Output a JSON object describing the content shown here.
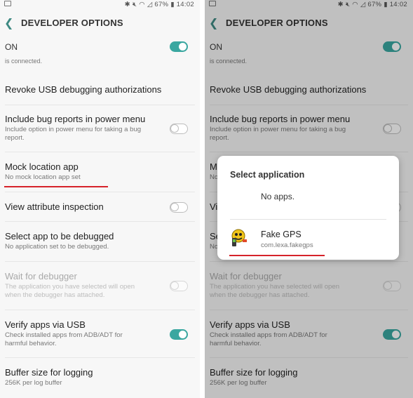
{
  "status": {
    "battery": "67%",
    "time": "14:02",
    "icons": [
      "image-icon",
      "bluetooth-icon",
      "mute-icon",
      "wifi-icon",
      "no-signal-icon",
      "battery-icon"
    ]
  },
  "header": {
    "title": "DEVELOPER OPTIONS"
  },
  "master": {
    "label": "ON",
    "on": true
  },
  "cut_subtitle": "is connected.",
  "rows": [
    {
      "title": "Revoke USB debugging authorizations",
      "subtitle": ""
    },
    {
      "title": "Include bug reports in power menu",
      "subtitle": "Include option in power menu for taking a bug report.",
      "toggle": "off"
    },
    {
      "title": "Mock location app",
      "subtitle": "No mock location app set"
    },
    {
      "title": "View attribute inspection",
      "subtitle": "",
      "toggle": "off"
    },
    {
      "title": "Select app to be debugged",
      "subtitle": "No application set to be debugged."
    },
    {
      "title": "Wait for debugger",
      "subtitle": "The application you have selected will open when the debugger has attached.",
      "toggle": "off",
      "disabled": true
    },
    {
      "title": "Verify apps via USB",
      "subtitle": "Check installed apps from ADB/ADT for harmful behavior.",
      "toggle": "on"
    },
    {
      "title": "Buffer size for logging",
      "subtitle": "256K per log buffer"
    }
  ],
  "dialog": {
    "title": "Select application",
    "option_none": "No apps.",
    "app": {
      "name": "Fake GPS",
      "package": "com.lexa.fakegps",
      "icon": "fake-gps-app-icon"
    }
  },
  "colors": {
    "accent": "#3aa7a0",
    "highlight": "#d6222a"
  }
}
